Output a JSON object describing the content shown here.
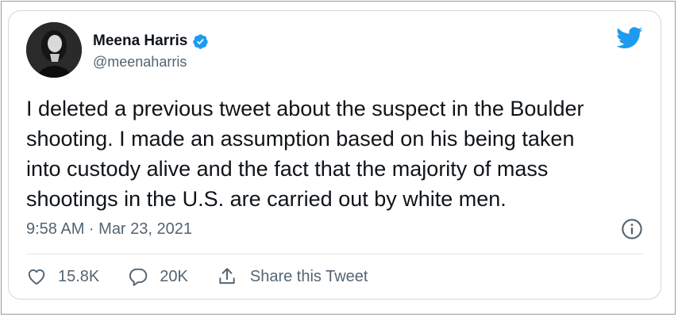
{
  "author": {
    "name": "Meena Harris",
    "handle": "@meenaharris"
  },
  "tweet": {
    "lines": [
      "I deleted a previous tweet about the suspect in the Boulder",
      "shooting. I made an assumption based on his being taken",
      "into custody alive and the fact that the majority of mass",
      "shootings in the U.S. are carried out by white men."
    ],
    "timestamp": "9:58 AM · Mar 23, 2021"
  },
  "actions": {
    "likes": "15.8K",
    "replies": "20K",
    "share_label": "Share this Tweet"
  },
  "colors": {
    "twitter_blue": "#1d9bf0",
    "text": "#0f1419",
    "muted": "#536471",
    "border": "#cfd9de"
  },
  "icons": [
    "verified-badge-icon",
    "twitter-bird-icon",
    "info-icon",
    "heart-icon",
    "reply-bubble-icon",
    "share-icon"
  ]
}
